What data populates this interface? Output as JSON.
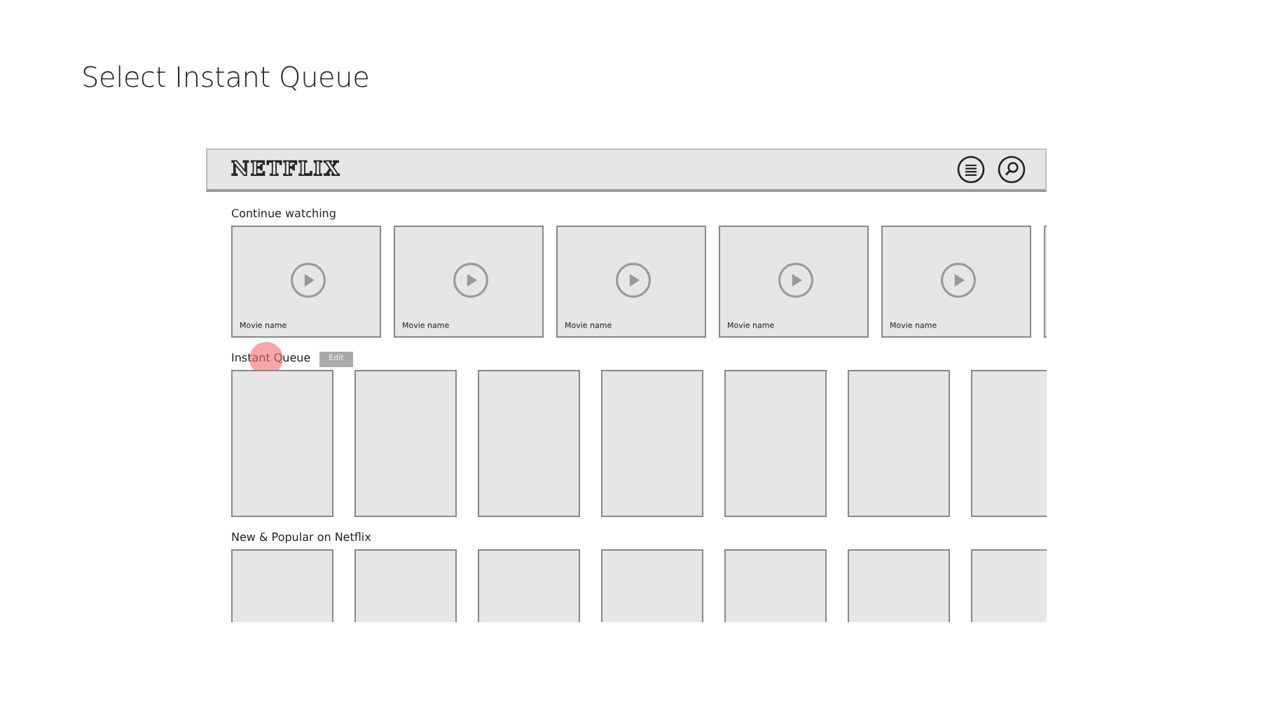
{
  "slide_title": "Select Instant Queue",
  "app": {
    "logo": "NETFLIX",
    "sections": [
      {
        "title": "Continue watching",
        "kind": "landscape",
        "tapped": false,
        "tiles": [
          {
            "name": "Movie name"
          },
          {
            "name": "Movie name"
          },
          {
            "name": "Movie name"
          },
          {
            "name": "Movie name"
          },
          {
            "name": "Movie name"
          },
          {
            "kind": "blank"
          }
        ]
      },
      {
        "title": "Instant Queue",
        "kind": "poster",
        "tapped": true,
        "button": "Edit",
        "tiles": [
          {
            "kind": "blank"
          },
          {
            "kind": "blank"
          },
          {
            "kind": "blank"
          },
          {
            "kind": "blank"
          },
          {
            "kind": "blank"
          },
          {
            "kind": "blank"
          },
          {
            "kind": "blank"
          }
        ]
      },
      {
        "title": "New & Popular on Netflix",
        "kind": "poster",
        "tapped": false,
        "tiles": [
          {
            "kind": "blank"
          },
          {
            "kind": "blank"
          },
          {
            "kind": "blank"
          },
          {
            "kind": "blank"
          },
          {
            "kind": "blank"
          },
          {
            "kind": "blank"
          },
          {
            "kind": "blank"
          }
        ]
      }
    ]
  }
}
